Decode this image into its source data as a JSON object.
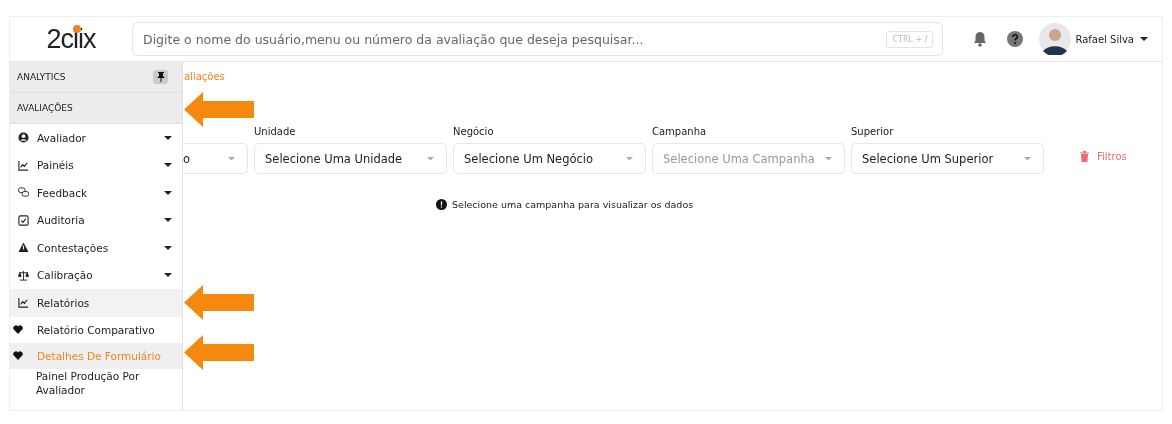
{
  "header": {
    "logo": "2clix",
    "search": {
      "placeholder": "Digite o nome do usuário,menu ou número da avaliação que deseja pesquisar...",
      "shortcut": "CTRL + /"
    },
    "user": {
      "name": "Rafael Silva"
    }
  },
  "sidebar": {
    "sections": [
      {
        "label": "ANALYTICS",
        "pinned": true
      },
      {
        "label": "AVALIAÇÕES",
        "pinned": false
      }
    ],
    "items": [
      {
        "label": "Avaliador",
        "expanded": false
      },
      {
        "label": "Painéis",
        "expanded": false
      },
      {
        "label": "Feedback",
        "expanded": false
      },
      {
        "label": "Auditoria",
        "expanded": false
      },
      {
        "label": "Contestações",
        "expanded": false
      },
      {
        "label": "Calibração",
        "expanded": false
      },
      {
        "label": "Relatórios",
        "expanded": true,
        "children": [
          {
            "label": "Relatório Comparativo",
            "favorite": true,
            "selected": false
          },
          {
            "label": "Detalhes De Formulário",
            "favorite": true,
            "selected": true
          },
          {
            "label": "Painel Produção Por Avaliador",
            "favorite": false,
            "selected": false
          }
        ]
      }
    ]
  },
  "content": {
    "breadcrumb": "aliações",
    "filters": [
      {
        "value": "o",
        "disabled": false,
        "cut": true
      },
      {
        "label": "Unidade",
        "value": "Selecione Uma Unidade",
        "disabled": false,
        "cut": false
      },
      {
        "label": "Negócio",
        "value": "Selecione Um Negócio",
        "disabled": false,
        "cut": false
      },
      {
        "label": "Campanha",
        "value": "Selecione Uma Campanha",
        "disabled": true,
        "cut": false
      },
      {
        "label": "Superior",
        "value": "Selecione Um Superior",
        "disabled": false,
        "cut": false
      }
    ],
    "clear_button": "Filtros",
    "message": "Selecione uma campanha para visualizar os dados"
  },
  "annotations": [
    {
      "kind": "arrow"
    },
    {
      "kind": "arrow"
    },
    {
      "kind": "arrow"
    }
  ]
}
